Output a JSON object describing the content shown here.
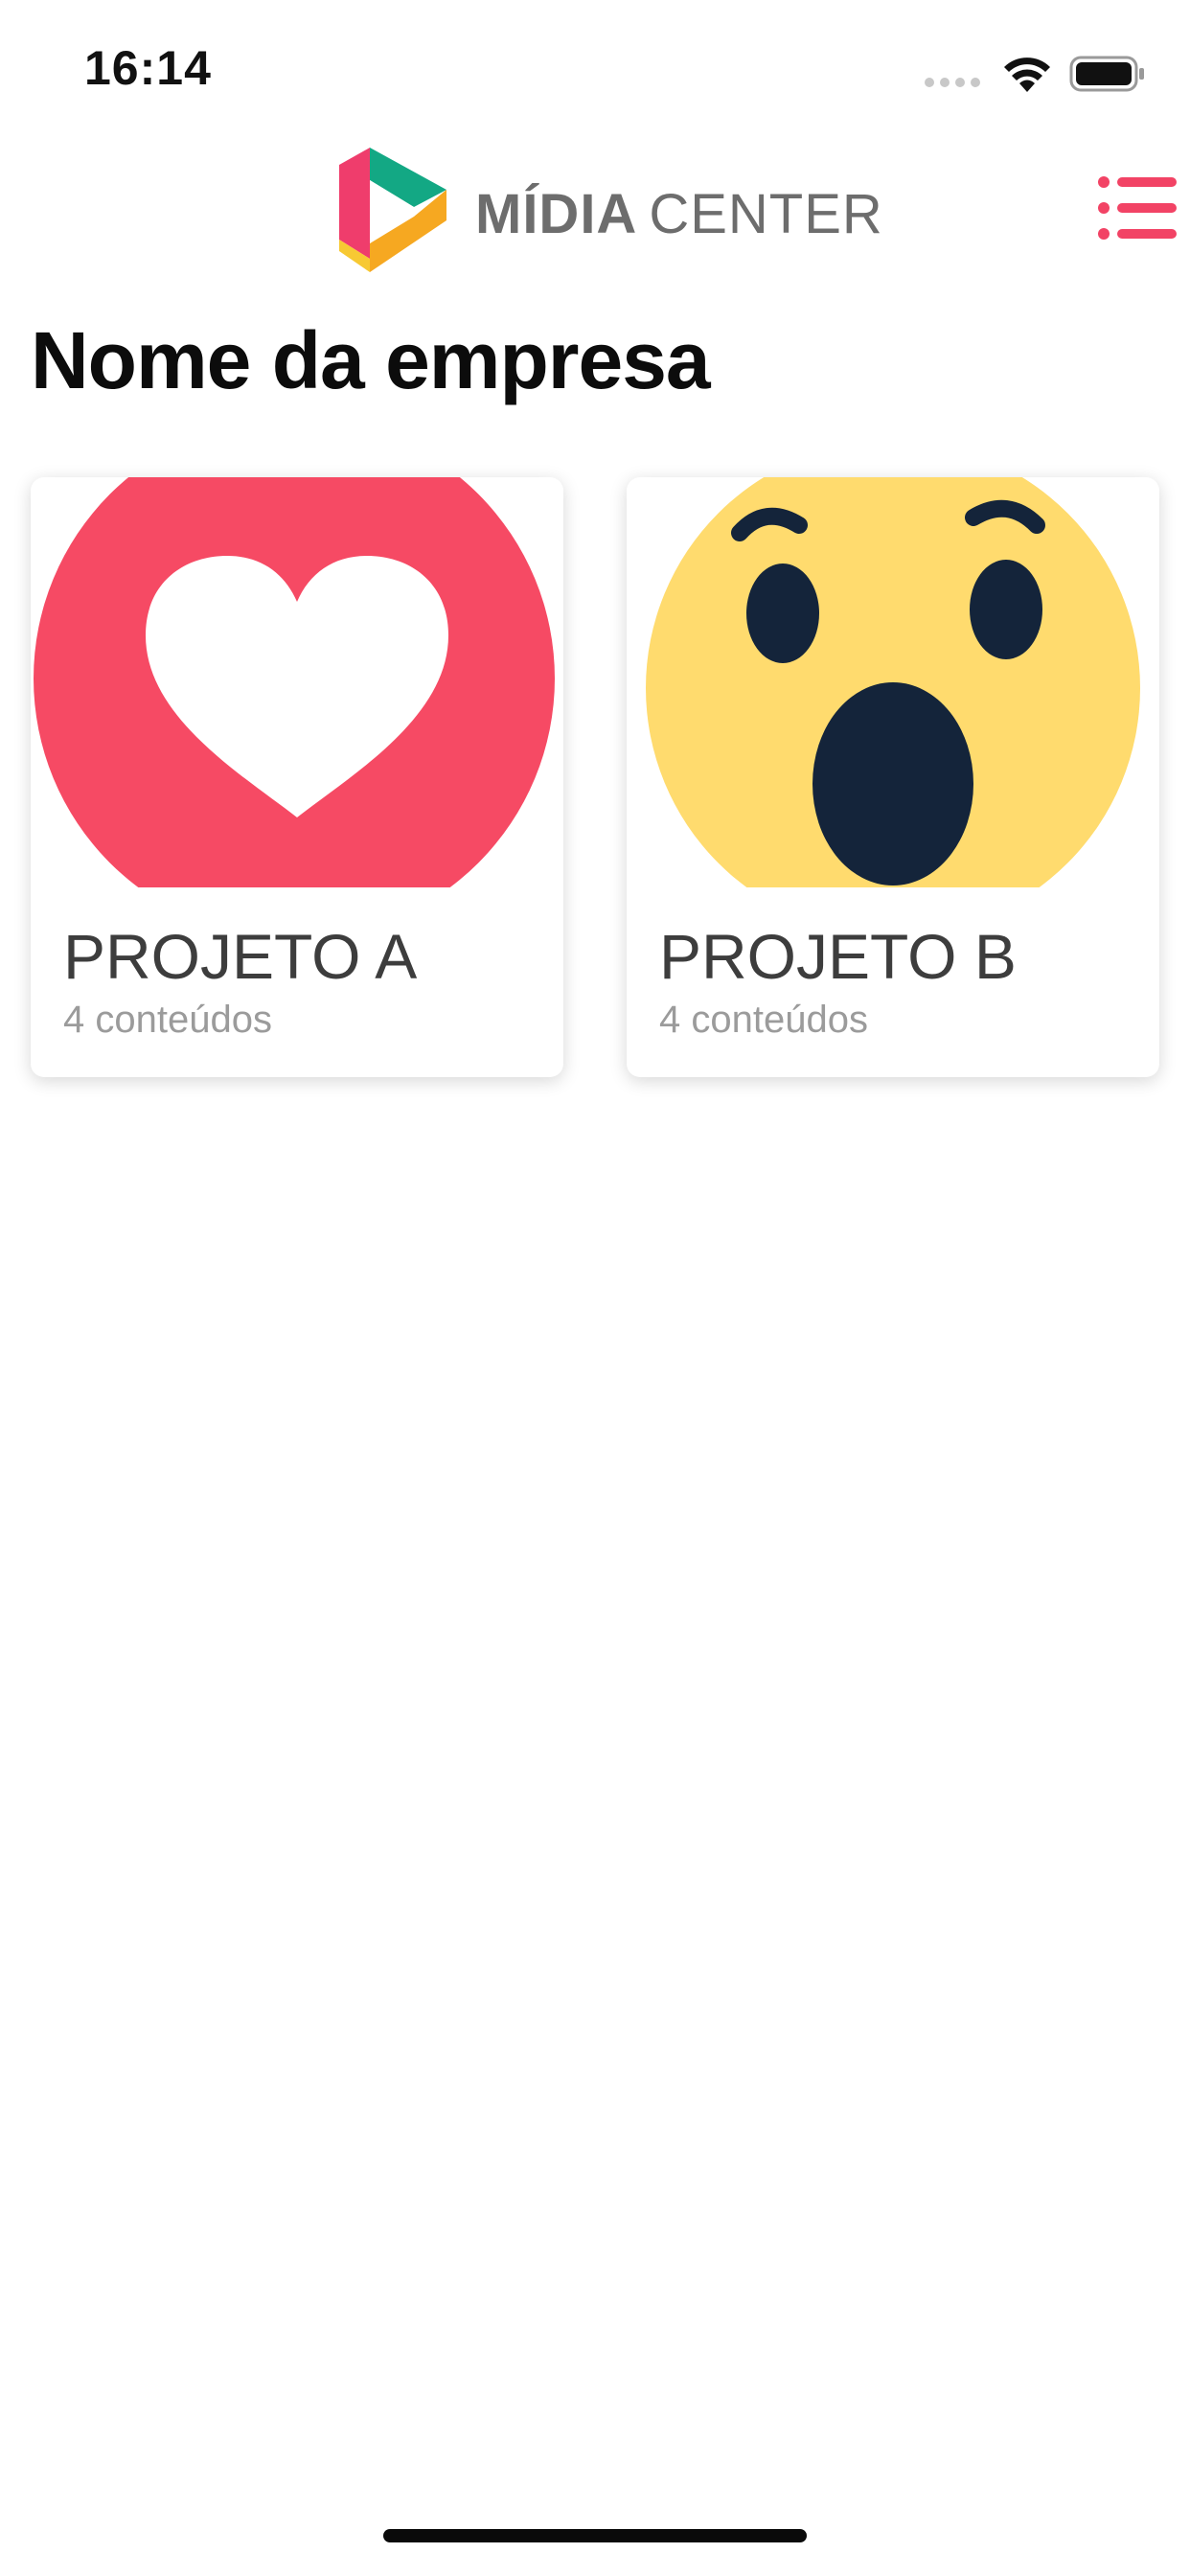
{
  "status_bar": {
    "time": "16:14"
  },
  "header": {
    "logo_text_bold": "MÍDIA",
    "logo_text_light": "CENTER",
    "menu_icon": "list-menu-icon"
  },
  "page": {
    "title": "Nome da empresa"
  },
  "projects": [
    {
      "title": "PROJETO A",
      "subtitle": "4 conteúdos",
      "thumbnail_icon": "heart-reaction-icon"
    },
    {
      "title": "PROJETO B",
      "subtitle": "4 conteúdos",
      "thumbnail_icon": "wow-reaction-icon"
    }
  ],
  "colors": {
    "accent": "#f24365",
    "logo_gray": "#6d6d6d",
    "heart_red": "#f64a64",
    "wow_yellow": "#ffdb6e",
    "wow_dark": "#14243a"
  }
}
